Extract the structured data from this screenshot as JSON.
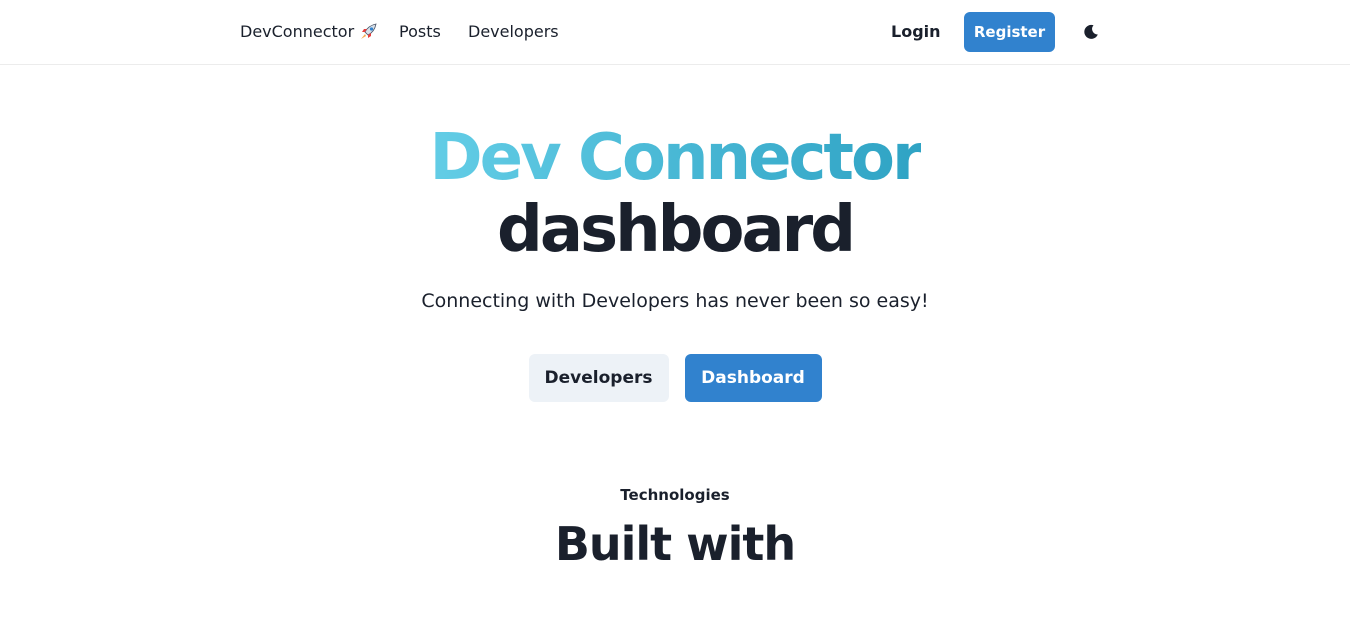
{
  "navbar": {
    "brand_label": "DevConnector",
    "brand_icon": "rocket-icon",
    "links": [
      {
        "label": "Posts"
      },
      {
        "label": "Developers"
      }
    ],
    "login_label": "Login",
    "register_label": "Register",
    "theme_icon": "moon-icon"
  },
  "hero": {
    "title_accent": "Dev Connector",
    "title_main": "dashboard",
    "subtitle": "Connecting with Developers has never been so easy!",
    "buttons": {
      "secondary_label": "Developers",
      "primary_label": "Dashboard"
    }
  },
  "technologies": {
    "label": "Technologies",
    "title": "Built with"
  },
  "colors": {
    "accent": "#3182ce",
    "gradient_start": "#63cde6",
    "gradient_end": "#2fa3c4",
    "text": "#1a202c",
    "secondary_button_bg": "#edf2f7"
  }
}
